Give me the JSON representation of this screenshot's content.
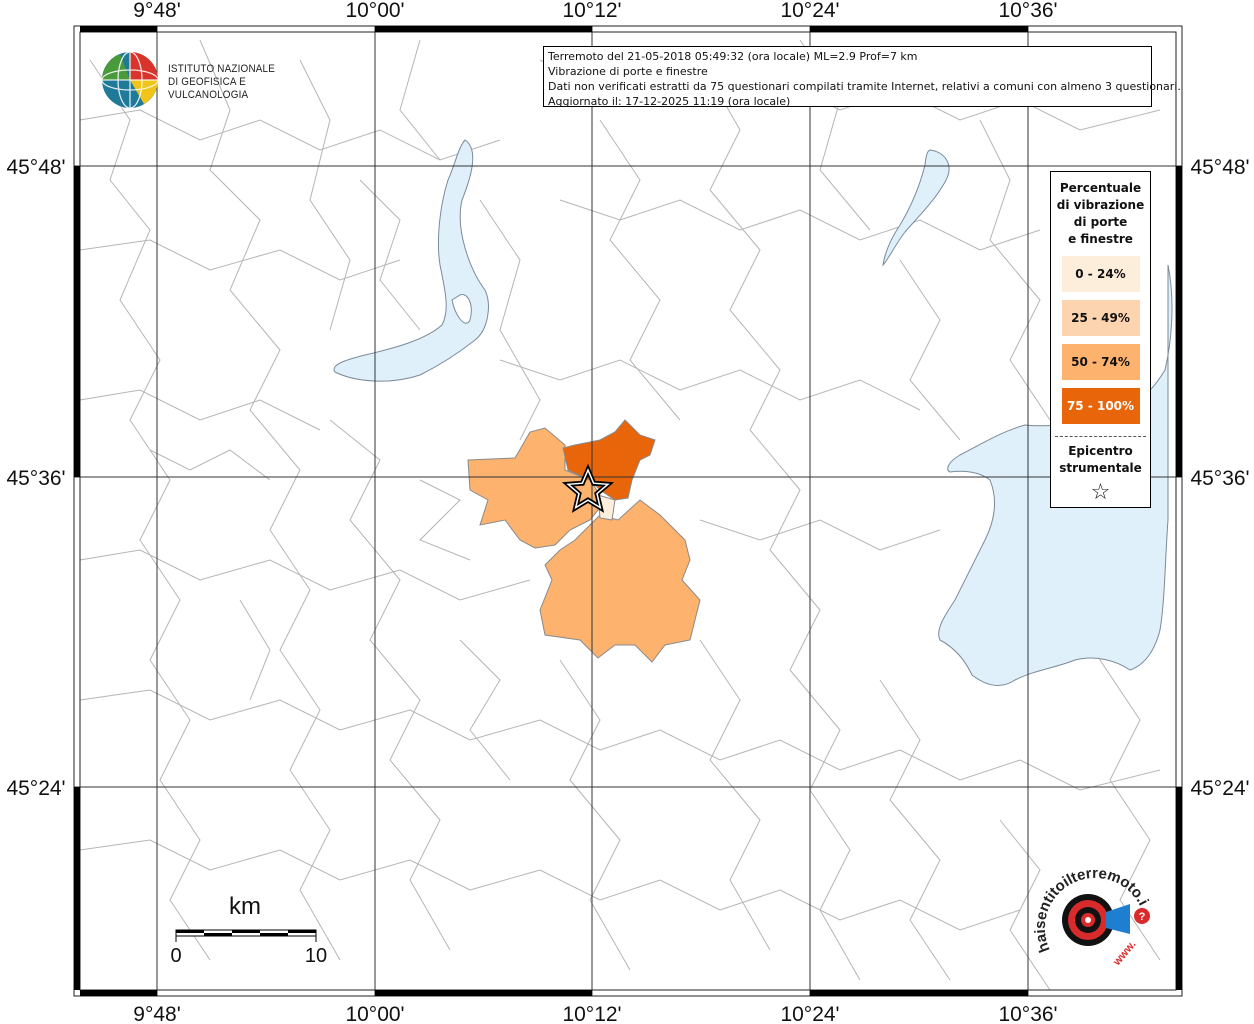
{
  "map": {
    "top_ticks": [
      "9°48'",
      "10°00'",
      "10°12'",
      "10°24'",
      "10°36'"
    ],
    "bottom_ticks": [
      "9°48'",
      "10°00'",
      "10°12'",
      "10°24'",
      "10°36'"
    ],
    "left_ticks": [
      "45°48'",
      "45°36'",
      "45°24'"
    ],
    "right_ticks": [
      "45°48'",
      "45°36'",
      "45°24'"
    ]
  },
  "info": {
    "line1": "Terremoto del 21-05-2018 05:49:32 (ora locale) ML=2.9 Prof=7 km",
    "line2": "Vibrazione di porte e finestre",
    "line3": "Dati non verificati estratti da 75 questionari compilati tramite Internet, relativi a comuni con almeno 3 questionari.",
    "line4": "Aggiornato il: 17-12-2025 11:19 (ora locale)"
  },
  "logo": {
    "line1": "ISTITUTO NAZIONALE",
    "line2": "DI GEOFISICA E VULCANOLOGIA"
  },
  "legend": {
    "title": "Percentuale\ndi vibrazione\ndi porte\ne finestre",
    "items": [
      {
        "label": "0 - 24%",
        "color": "#fdeedc"
      },
      {
        "label": "25 - 49%",
        "color": "#fdd4b0"
      },
      {
        "label": "50 - 74%",
        "color": "#fdb26e"
      },
      {
        "label": "75 - 100%",
        "color": "#e8650a"
      }
    ],
    "epicenter_label": "Epicentro\nstrumentale",
    "star": "☆"
  },
  "scale": {
    "unit": "km",
    "start": "0",
    "end": "10"
  },
  "brand": {
    "text": "haisentitoilterremoto.it",
    "www": "www."
  },
  "colors": {
    "lake": "#dff0fb",
    "lake_border": "#7a8a99"
  }
}
